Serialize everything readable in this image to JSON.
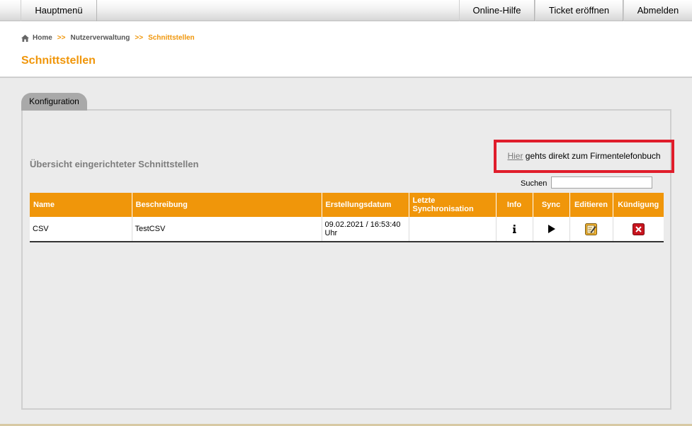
{
  "nav": {
    "main_menu": "Hauptmenü",
    "help": "Online-Hilfe",
    "ticket": "Ticket eröffnen",
    "logout": "Abmelden"
  },
  "breadcrumb": {
    "home": "Home",
    "separator": ">>",
    "users": "Nutzerverwaltung",
    "current": "Schnittstellen"
  },
  "page_title": "Schnittstellen",
  "tab_label": "Konfiguration",
  "section_title": "Übersicht eingerichteter Schnittstellen",
  "phonebook": {
    "link_text": "Hier",
    "rest_text": " gehts direkt zum Firmentelefonbuch"
  },
  "search": {
    "label": "Suchen",
    "value": ""
  },
  "table": {
    "headers": {
      "name": "Name",
      "description": "Beschreibung",
      "created": "Erstellungsdatum",
      "last_sync": "Letzte Synchronisation",
      "info": "Info",
      "sync": "Sync",
      "edit": "Editieren",
      "cancel": "Kündigung"
    },
    "rows": [
      {
        "name": "CSV",
        "description": "TestCSV",
        "created": "09.02.2021 / 16:53:40 Uhr",
        "last_sync": ""
      }
    ]
  },
  "icons": {
    "home": "home-icon",
    "info": "info-icon",
    "sync": "play-icon",
    "edit": "edit-icon",
    "cancel": "close-icon"
  },
  "colors": {
    "accent": "#f0960a",
    "highlight_box": "#e01d2b",
    "cancel_icon": "#c8141e",
    "edit_icon": "#f2b230"
  }
}
